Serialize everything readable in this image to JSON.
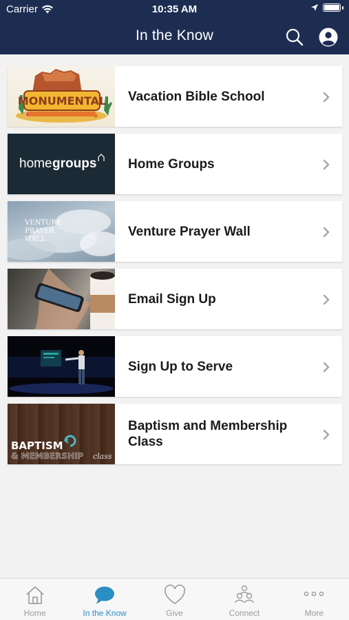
{
  "status_bar": {
    "carrier": "Carrier",
    "time": "10:35 AM"
  },
  "nav": {
    "title": "In the Know"
  },
  "thumbs": {
    "vbs_logo": "MONUMENTAL",
    "home_groups_a": "home",
    "home_groups_b": "groups",
    "prayer_a": "VENTURE",
    "prayer_b": "PRAYER",
    "prayer_c": "WALL",
    "baptism_a": "BAPTISM",
    "baptism_b": "& MEMBERSHIP",
    "baptism_c": "class"
  },
  "items": [
    {
      "label": "Vacation Bible School"
    },
    {
      "label": "Home Groups"
    },
    {
      "label": "Venture Prayer Wall"
    },
    {
      "label": "Email Sign Up"
    },
    {
      "label": "Sign Up to Serve"
    },
    {
      "label": "Baptism and Membership Class"
    }
  ],
  "tabs": [
    {
      "label": "Home",
      "icon": "home-icon"
    },
    {
      "label": "In the Know",
      "icon": "chat-bubble-icon",
      "active": true
    },
    {
      "label": "Give",
      "icon": "heart-icon"
    },
    {
      "label": "Connect",
      "icon": "people-icon"
    },
    {
      "label": "More",
      "icon": "more-dots-icon"
    }
  ],
  "colors": {
    "header": "#1d2d52",
    "accent": "#2b8ec4",
    "inactive_tab": "#9a9a9a"
  }
}
